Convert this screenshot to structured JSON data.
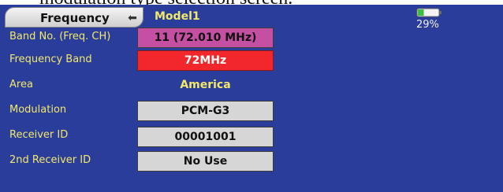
{
  "caption": "modulation type selection screen.",
  "header": {
    "title": "Frequency",
    "model_name": "Model1",
    "battery_percent_label": "29%",
    "battery_level": 0.29,
    "back_icon": "return-arrow-icon"
  },
  "rows": [
    {
      "label": "Band No. (Freq. CH)",
      "value": "11 (72.010 MHz)"
    },
    {
      "label": "Frequency Band",
      "value": "72MHz"
    },
    {
      "label": "Area",
      "value": "America"
    },
    {
      "label": "Modulation",
      "value": "PCM-G3"
    },
    {
      "label": "Receiver ID",
      "value": "00001001"
    },
    {
      "label": "2nd Receiver ID",
      "value": "No Use"
    }
  ],
  "colors": {
    "background": "#2b3d9a",
    "label_text": "#f2e86a",
    "band_button": "#c44fa3",
    "frequency_button": "#f2272b",
    "default_button": "#d6d6d6"
  }
}
